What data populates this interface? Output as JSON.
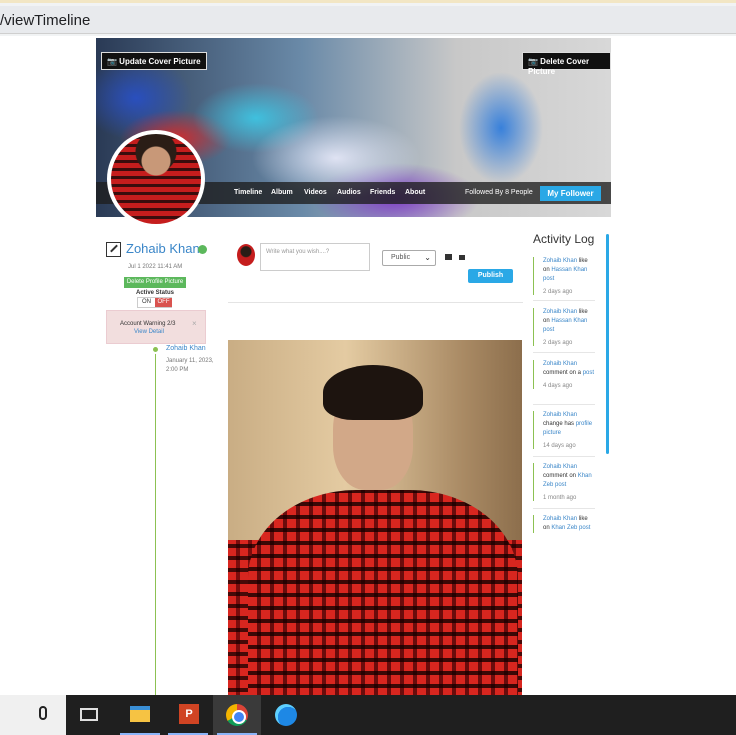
{
  "browser": {
    "url_fragment": "/viewTimeline"
  },
  "cover": {
    "update_btn": "📷 Update Cover Picture",
    "delete_btn": "📷 Delete Cover Picture",
    "nav": [
      "Timeline",
      "Album",
      "Videos",
      "Audios",
      "Friends",
      "About"
    ],
    "followed_by": "Followed By 8 People",
    "follower_btn": "My Follower"
  },
  "profile": {
    "name": "Zohaib Khan",
    "joined": "Jul 1 2022 11:41 AM",
    "delete_profile_btn": "Delete Profile Picture",
    "active_status_label": "Active Status",
    "toggle_on": "ON",
    "toggle_off": "OFF",
    "warning_text": "Account Warning 2/3",
    "warning_link": "View Detail",
    "warning_close": "×"
  },
  "timeline": {
    "name": "Zohaib Khan",
    "date": "January 11, 2023, 2:00 PM"
  },
  "composer": {
    "placeholder": "Write what you wish....?",
    "visibility": "Public",
    "publish": "Publish"
  },
  "activity": {
    "title": "Activity Log",
    "items": [
      {
        "who": "Zohaib Khan",
        "text": " like on ",
        "target": "Hassan Khan post",
        "ago": "2 days ago"
      },
      {
        "who": "Zohaib Khan",
        "text": " like on ",
        "target": "Hassan Khan post",
        "ago": "2 days ago"
      },
      {
        "who": "Zohaib Khan",
        "text": " comment on a ",
        "target": "post",
        "ago": "4 days ago"
      },
      {
        "who": "Zohaib Khan",
        "text": " change has ",
        "target": "profile picture",
        "ago": "14 days ago"
      },
      {
        "who": "Zohaib Khan",
        "text": " comment on ",
        "target": "Khan Zeb post",
        "ago": "1 month ago"
      },
      {
        "who": "Zohaib Khan",
        "text": " like on ",
        "target": "Khan Zeb post",
        "ago": ""
      }
    ]
  },
  "taskbar": {
    "apps": [
      "file-explorer-icon",
      "powerpoint-icon",
      "chrome-icon",
      "edge-icon"
    ],
    "ppt_label": "P"
  },
  "colors": {
    "accent": "#2aa8e6",
    "link": "#3a86c8",
    "success": "#5cb85c",
    "danger": "#d9534f",
    "timeline": "#8cc152"
  }
}
